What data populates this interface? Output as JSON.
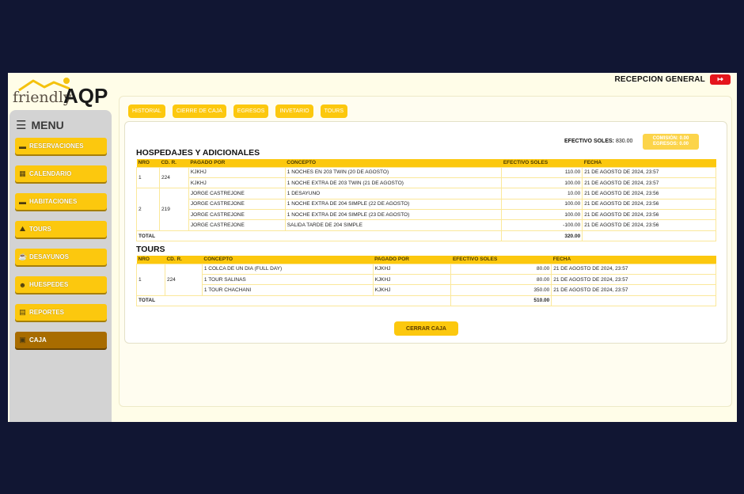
{
  "header": {
    "logo_word1": "friendly",
    "logo_word2": "AQP",
    "user_label": "RECEPCION GENERAL",
    "logout_icon": "logout-icon"
  },
  "sidebar": {
    "title": "MENU",
    "items": [
      {
        "label": "RESERVACIONES",
        "icon": "bed-icon",
        "glyph": "▬"
      },
      {
        "label": "CALENDARIO",
        "icon": "calendar-icon",
        "glyph": "▦"
      },
      {
        "label": "HABITACIONES",
        "icon": "bed-icon",
        "glyph": "▬"
      },
      {
        "label": "TOURS",
        "icon": "map-icon",
        "glyph": "⛰"
      },
      {
        "label": "DESAYUNOS",
        "icon": "breakfast-icon",
        "glyph": "☕"
      },
      {
        "label": "HUESPEDES",
        "icon": "users-icon",
        "glyph": "☻"
      },
      {
        "label": "REPORTES",
        "icon": "report-icon",
        "glyph": "▤"
      },
      {
        "label": "CAJA",
        "icon": "cash-register-icon",
        "glyph": "▣"
      }
    ],
    "active": "CAJA"
  },
  "tabs": [
    "HISTORIAL",
    "CIERRE DE CAJA",
    "EGRESOS",
    "INVETARIO",
    "TOURS"
  ],
  "summary": {
    "efectivo_label": "EFECTIVO SOLES:",
    "efectivo_value": "830.00",
    "comision": "COMISIÓN: 0.00",
    "egresos": "EGRESOS: 0.00"
  },
  "hospedajes": {
    "title": "HOSPEDAJES Y ADICIONALES",
    "headers": [
      "NRO",
      "CD. R.",
      "PAGADO POR",
      "CONCEPTO",
      "EFECTIVO SOLES",
      "FECHA"
    ],
    "groups": [
      {
        "nro": "1",
        "cdr": "224",
        "rows": [
          {
            "pagado": "KJKHJ",
            "concepto": "1 NOCHES EN 203 TWIN (20 DE AGOSTO)",
            "efectivo": "110.00",
            "fecha": "21 DE AGOSTO DE 2024, 23:57"
          },
          {
            "pagado": "KJKHJ",
            "concepto": "1 NOCHE EXTRA DE 203 TWIN (21 DE AGOSTO)",
            "efectivo": "100.00",
            "fecha": "21 DE AGOSTO DE 2024, 23:57"
          }
        ]
      },
      {
        "nro": "2",
        "cdr": "219",
        "rows": [
          {
            "pagado": "JORGE CASTREJONE",
            "concepto": "1 DESAYUNO",
            "efectivo": "10.00",
            "fecha": "21 DE AGOSTO DE 2024, 23:56"
          },
          {
            "pagado": "JORGE CASTREJONE",
            "concepto": "1 NOCHE EXTRA DE 204 SIMPLE (22 DE AGOSTO)",
            "efectivo": "100.00",
            "fecha": "21 DE AGOSTO DE 2024, 23:56"
          },
          {
            "pagado": "JORGE CASTREJONE",
            "concepto": "1 NOCHE EXTRA DE 204 SIMPLE (23 DE AGOSTO)",
            "efectivo": "100.00",
            "fecha": "21 DE AGOSTO DE 2024, 23:56"
          },
          {
            "pagado": "JORGE CASTREJONE",
            "concepto": "SALIDA TARDE DE 204 SIMPLE",
            "efectivo": "-100.00",
            "fecha": "21 DE AGOSTO DE 2024, 23:56"
          }
        ]
      }
    ],
    "total_label": "TOTAL",
    "total_value": "320.00"
  },
  "tours": {
    "title": "TOURS",
    "headers": [
      "NRO",
      "CD. R.",
      "CONCEPTO",
      "PAGADO POR",
      "EFECTIVO SOLES",
      "FECHA"
    ],
    "groups": [
      {
        "nro": "1",
        "cdr": "224",
        "rows": [
          {
            "concepto": "1 COLCA DE UN DIA (FULL DAY)",
            "pagado": "KJKHJ",
            "efectivo": "80.00",
            "fecha": "21 DE AGOSTO DE 2024, 23:57"
          },
          {
            "concepto": "1 TOUR SALINAS",
            "pagado": "KJKHJ",
            "efectivo": "80.00",
            "fecha": "21 DE AGOSTO DE 2024, 23:57"
          },
          {
            "concepto": "1 TOUR CHACHANI",
            "pagado": "KJKHJ",
            "efectivo": "350.00",
            "fecha": "21 DE AGOSTO DE 2024, 23:57"
          }
        ]
      }
    ],
    "total_label": "TOTAL",
    "total_value": "510.00"
  },
  "close_button": "CERRAR CAJA",
  "colors": {
    "accent": "#fcc80e",
    "active": "#a86c00",
    "logout": "#e5151c"
  }
}
